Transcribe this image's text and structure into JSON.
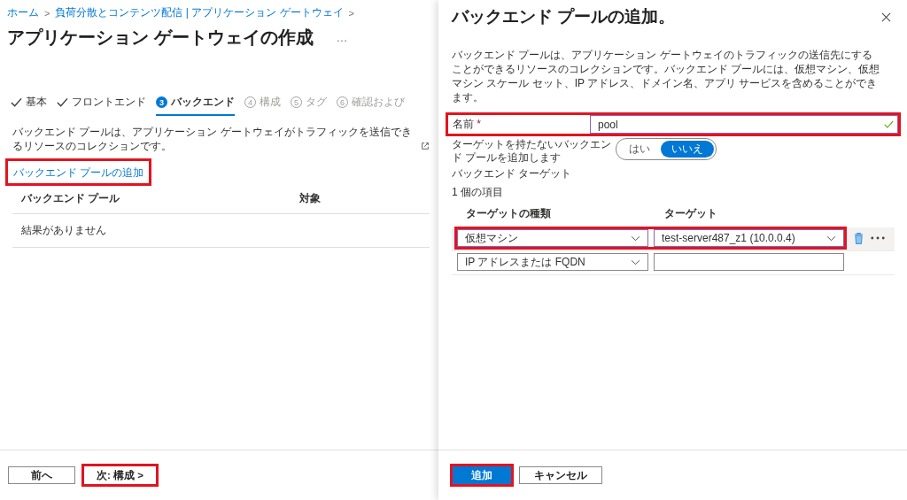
{
  "breadcrumb": [
    {
      "label": "ホーム"
    },
    {
      "label": "負荷分散とコンテンツ配信 | アプリケーション ゲートウェイ"
    }
  ],
  "breadcrumb_separator": ">",
  "page_title": "アプリケーション ゲートウェイの作成",
  "more_label": "…",
  "tabs": [
    {
      "label": "基本",
      "kind": "done",
      "selected": false
    },
    {
      "label": "フロントエンド",
      "kind": "done",
      "selected": false
    },
    {
      "label": "バックエンド",
      "number": "3",
      "kind": "current",
      "selected": true
    },
    {
      "label": "構成",
      "number": "4",
      "kind": "pending",
      "selected": false
    },
    {
      "label": "タグ",
      "number": "5",
      "kind": "pending",
      "selected": false
    },
    {
      "label": "確認および",
      "number": "6",
      "kind": "pending",
      "selected": false
    }
  ],
  "description": "バックエンド プールは、アプリケーション ゲートウェイがトラフィックを送信できるリソースのコレクションです。",
  "add_link": {
    "label": "バックエンド プールの追加",
    "highlighted": true
  },
  "table": {
    "columns": [
      "バックエンド プール",
      "対象"
    ],
    "empty_text": "結果がありません"
  },
  "footer_buttons": [
    {
      "label": "前へ",
      "kind": "secondary",
      "highlighted": false
    },
    {
      "label": "次: 構成 >",
      "kind": "plain",
      "highlighted": true
    }
  ],
  "panel": {
    "title": "バックエンド プールの追加。",
    "description": "バックエンド プールは、アプリケーション ゲートウェイのトラフィックの送信先にすることができるリソースのコレクションです。バックエンド プールには、仮想マシン、仮想マシン スケール セット、IP アドレス、ドメイン名、アプリ サービスを含めることができます。",
    "name_field": {
      "label": "名前",
      "required_mark": "*",
      "value": "pool",
      "valid": true,
      "highlighted": true
    },
    "no_target_toggle": {
      "label": "ターゲットを持たないバックエンド プールを追加します",
      "options": [
        {
          "label": "はい",
          "selected": false
        },
        {
          "label": "いいえ",
          "selected": true
        }
      ]
    },
    "targets_heading": "バックエンド ターゲット",
    "item_count": "1 個の項目",
    "targets_table": {
      "columns": [
        "ターゲットの種類",
        "ターゲット"
      ],
      "rows": [
        {
          "type": "仮想マシン",
          "target": "test-server487_z1 (10.0.0.4)",
          "kind": "dropdown",
          "highlighted": true,
          "hovered": true
        },
        {
          "type": "IP アドレスまたは FQDN",
          "target": "",
          "kind": "input",
          "highlighted": false,
          "hovered": false
        }
      ]
    },
    "buttons": [
      {
        "label": "追加",
        "kind": "primary",
        "highlighted": true
      },
      {
        "label": "キャンセル",
        "kind": "secondary",
        "highlighted": false
      }
    ]
  }
}
